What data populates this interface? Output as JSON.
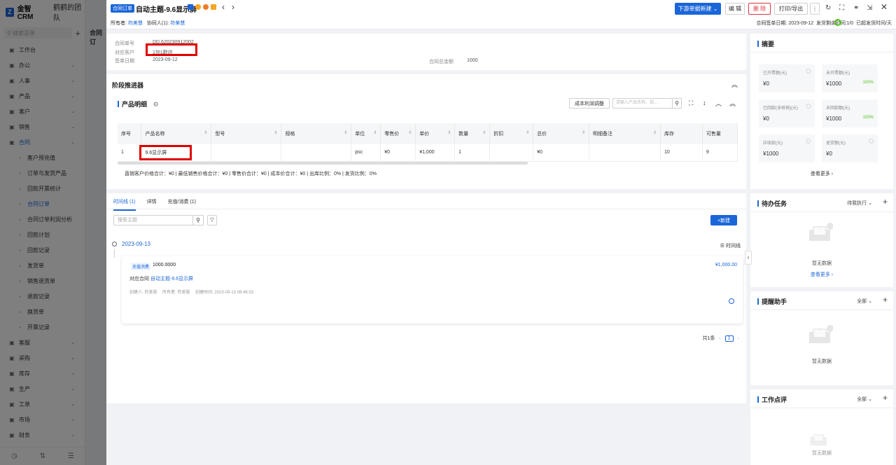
{
  "app": {
    "brand": "金智CRM",
    "team": "鹤鹤的团队"
  },
  "sidebar": {
    "search_placeholder": "搜索菜单",
    "items": [
      {
        "label": "工作台",
        "icon": "dashboard-icon",
        "has_children": false
      },
      {
        "label": "办公",
        "icon": "office-icon",
        "has_children": true
      },
      {
        "label": "人事",
        "icon": "person-icon",
        "has_children": true
      },
      {
        "label": "产品",
        "icon": "product-icon",
        "has_children": true
      },
      {
        "label": "客户",
        "icon": "customer-icon",
        "has_children": true
      },
      {
        "label": "销售",
        "icon": "sales-icon",
        "has_children": true
      },
      {
        "label": "合同",
        "icon": "contract-icon",
        "has_children": true,
        "active": true
      }
    ],
    "sub_items": [
      "客户预充值",
      "订单与发货产品",
      "回款开票统计",
      "合同订单",
      "合同订单利润分析",
      "回款计划",
      "回款记录",
      "发货单",
      "销售退货单",
      "退款记录",
      "换货单",
      "开票记录"
    ],
    "more_items": [
      {
        "label": "客服",
        "icon": "service-icon"
      },
      {
        "label": "采购",
        "icon": "purchase-icon"
      },
      {
        "label": "库存",
        "icon": "inventory-icon"
      },
      {
        "label": "生产",
        "icon": "production-icon"
      },
      {
        "label": "工单",
        "icon": "workorder-icon"
      },
      {
        "label": "市场",
        "icon": "market-icon"
      },
      {
        "label": "财务",
        "icon": "finance-icon"
      }
    ]
  },
  "background_title": "合同订",
  "header": {
    "type_tag": "合同订单",
    "title": "自动主题-9.6显示屏",
    "owner_label": "所有者:",
    "owner": "符美慧",
    "collab_label": "协同人(1):",
    "collab": "符美慧",
    "buttons": {
      "new_order": "下游单据新建 ⌄",
      "edit": "编 辑",
      "delete": "删 除",
      "print": "打印/导出"
    },
    "sign_date_label": "合同签单日期:",
    "sign_date": "2023-09-12",
    "remaining_label": "发货剩余时间:",
    "progress": "1/0",
    "status": "已超发货时间/天"
  },
  "info": {
    "order_no_label": "合同单号",
    "order_no": "DD.620230912002",
    "customer_label": "对应客户",
    "customer": "1加1鞋店",
    "sign_date_label": "签单日期",
    "sign_date": "2023-09-12",
    "total_label": "合同总金额",
    "total": "1000"
  },
  "stage": {
    "title": "阶段推进器"
  },
  "products": {
    "title": "产品明细",
    "cost_button": "成本利润调整",
    "search_placeholder": "请输入产品名称、规...",
    "columns": [
      "序号",
      "产品名称",
      "型号",
      "规格",
      "单位",
      "零售价",
      "单价",
      "数量",
      "折扣",
      "总价",
      "明细备注",
      "库存",
      "可售量"
    ],
    "rows": [
      [
        "1",
        "9.6显示屏",
        "",
        "",
        "psc",
        "¥0",
        "¥1,000",
        "1",
        "",
        "¥0",
        "",
        "10",
        "9"
      ]
    ],
    "totals": "直销客户价格合计：¥0 | 最低销售价格合计：¥0 | 零售价合计：¥0 | 成本价合计：¥0 | 出库比例：0% | 发货比例：0%"
  },
  "timeline": {
    "tabs": [
      "时间线 (1)",
      "详情",
      "充值/消费 (1)"
    ],
    "search_placeholder": "搜索主题",
    "new_button": "+新建",
    "date": "2023-09-13",
    "view_label": "时间线",
    "entry": {
      "tag": "充值消费",
      "amount": "1000.0000",
      "amount_right": "¥1,000.00",
      "contract_label": "对应合同",
      "contract": "自动主题-9.6显示屏",
      "meta": "创建人: 符美慧　 所有者: 符美慧　 创建时间: 2023-09-13 08:46:33"
    },
    "pager": {
      "total": "共1条",
      "page": "1"
    }
  },
  "summary": {
    "title": "摘要",
    "cells": [
      {
        "label": "已开票额(元)",
        "value": "¥0",
        "pct": ""
      },
      {
        "label": "未开票额(元)",
        "value": "¥1000",
        "pct": "100%"
      },
      {
        "label": "已回款(含核销)(元)",
        "value": "¥0",
        "pct": ""
      },
      {
        "label": "未回款额(元)",
        "value": "¥1000",
        "pct": "100%"
      },
      {
        "label": "应收款(元)",
        "value": "¥1000",
        "pct": ""
      },
      {
        "label": "退货额(元)",
        "value": "¥0",
        "pct": ""
      }
    ],
    "more": "查看更多 ›"
  },
  "tasks": {
    "title": "待办任务",
    "filter": "待我执行",
    "empty": "暂无数据",
    "more": "查看更多 ›"
  },
  "reminder": {
    "title": "提醒助手",
    "filter": "全部",
    "empty": "暂无数据"
  },
  "review": {
    "title": "工作点评",
    "filter": "全部",
    "empty": "暂无数据"
  }
}
